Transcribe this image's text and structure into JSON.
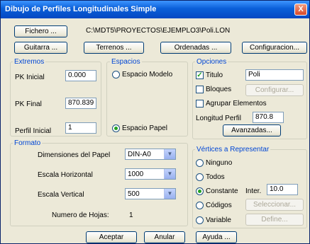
{
  "window": {
    "title": "Dibujo de Perfiles Longitudinales Simple",
    "close_glyph": "X"
  },
  "top": {
    "fichero_label": "Fichero ...",
    "path": "C:\\MDT5\\PROYECTOS\\EJEMPLO3\\Poli.LON",
    "guitarra_label": "Guitarra ...",
    "terrenos_label": "Terrenos ...",
    "ordenadas_label": "Ordenadas ...",
    "configuracion_label": "Configuracion..."
  },
  "extremos": {
    "legend": "Extremos",
    "pk_inicial_label": "PK Inicial",
    "pk_inicial_value": "0.000",
    "pk_final_label": "PK Final",
    "pk_final_value": "870.839",
    "perfil_inicial_label": "Perfil Inicial",
    "perfil_inicial_value": "1"
  },
  "espacios": {
    "legend": "Espacios",
    "modelo_label": "Espacio Modelo",
    "papel_label": "Espacio Papel",
    "selected": "papel"
  },
  "opciones": {
    "legend": "Opciones",
    "titulo_label": "Titulo",
    "titulo_checked": true,
    "titulo_value": "Poli",
    "bloques_label": "Bloques",
    "bloques_checked": false,
    "configurar_label": "Configurar...",
    "agrupar_label": "Agrupar Elementos",
    "agrupar_checked": false,
    "longitud_label": "Longitud Perfil",
    "longitud_value": "870.8",
    "avanzadas_label": "Avanzadas..."
  },
  "formato": {
    "legend": "Formato",
    "dimensiones_label": "Dimensiones del Papel",
    "dimensiones_value": "DIN-A0",
    "escala_h_label": "Escala Horizontal",
    "escala_h_value": "1000",
    "escala_v_label": "Escala Vertical",
    "escala_v_value": "500",
    "hojas_label": "Numero de Hojas:",
    "hojas_value": "1"
  },
  "vertices": {
    "legend": "Vértices a Representar",
    "ninguno_label": "Ninguno",
    "todos_label": "Todos",
    "constante_label": "Constante",
    "codigos_label": "Códigos",
    "variable_label": "Variable",
    "selected": "constante",
    "inter_label": "Inter.",
    "inter_value": "10.0",
    "seleccionar_label": "Seleccionar...",
    "define_label": "Define..."
  },
  "bottom": {
    "aceptar_label": "Aceptar",
    "anular_label": "Anular",
    "ayuda_label": "Ayuda ..."
  },
  "colors": {
    "title_bar": "#0a5fd8",
    "legend_text": "#0046d5",
    "dialog_bg": "#ece9d8",
    "radio_dot": "#21a121"
  }
}
